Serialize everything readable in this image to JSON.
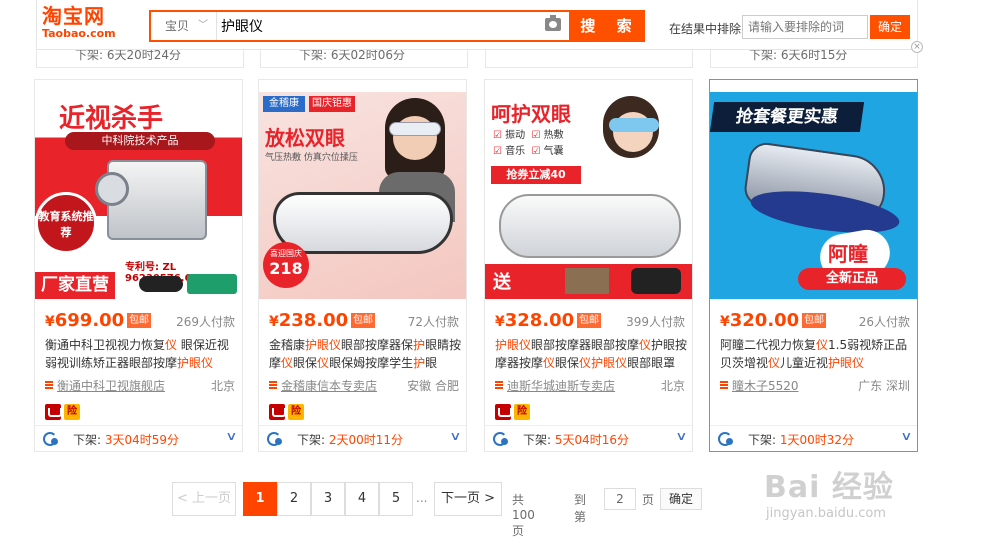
{
  "header": {
    "logo_cn": "淘宝网",
    "logo_en": "Taobao.com",
    "search_type": "宝贝",
    "search_query": "护眼仪",
    "search_button": "搜 索",
    "filter_label": "在结果中排除",
    "filter_placeholder": "请输入要排除的词",
    "filter_button": "确定",
    "close": "×"
  },
  "prev_row": [
    {
      "prefix": "下架: ",
      "value": "6天20时24分"
    },
    {
      "prefix": "下架: ",
      "value": "6天02时06分"
    },
    {
      "prefix": "",
      "value": ""
    },
    {
      "prefix": "下架: ",
      "value": "6天6时15分"
    }
  ],
  "products": [
    {
      "yen": "¥",
      "price": "699.00",
      "free_shipping": "包邮",
      "deals": "269人付款",
      "title_parts": [
        "衡通中科卫视视力恢复",
        "仪",
        " 眼保近视弱视训练矫正器眼部按摩",
        "护眼仪"
      ],
      "shop": "衡通中科卫视旗舰店",
      "location": "北京",
      "gold_badge": "险",
      "offline_label": "下架: ",
      "offline_time": "3天04时59分",
      "image": {
        "headline": "近视杀手",
        "sub": "中科院技术产品",
        "badge": "教育系统推荐",
        "patent": "专利号: ZL 96230576.6",
        "footer": "厂家直营"
      }
    },
    {
      "yen": "¥",
      "price": "238.00",
      "free_shipping": "包邮",
      "deals": "72人付款",
      "title_parts": [
        "金稽康",
        "护眼仪",
        "眼部按摩器保",
        "护",
        "眼睛按摩",
        "仪",
        "眼保",
        "仪",
        "眼保姆按摩学生",
        "护",
        "眼"
      ],
      "shop": "金稽康信本专卖店",
      "location": "安徽 合肥",
      "gold_badge": "险",
      "offline_label": "下架: ",
      "offline_time": "2天00时11分",
      "image": {
        "brand": "金稽康",
        "tag": "国庆钜惠",
        "headline": "放松双眼",
        "sub": "气压热敷 仿真穴位揉压",
        "promo": "喜迎国庆",
        "promo_price": "218"
      }
    },
    {
      "yen": "¥",
      "price": "328.00",
      "free_shipping": "包邮",
      "deals": "399人付款",
      "title_parts": [
        "护眼仪",
        "眼部按摩器眼部按摩",
        "仪",
        "护眼按摩器按摩",
        "仪",
        "眼保",
        "仪",
        "护眼",
        "仪",
        "眼部眼罩"
      ],
      "shop": "迪斯华城迪斯专卖店",
      "location": "北京",
      "gold_badge": "险",
      "offline_label": "下架: ",
      "offline_time": "5天04时16分",
      "image": {
        "headline": "呵护双眼",
        "features": [
          "振动",
          "热敷",
          "音乐",
          "气囊"
        ],
        "coupon": "抢券立减40",
        "gift": "送"
      }
    },
    {
      "yen": "¥",
      "price": "320.00",
      "free_shipping": "包邮",
      "deals": "26人付款",
      "title_parts": [
        "阿瞳二代视力恢复",
        "仪",
        "1.5弱视矫正品贝茨增视",
        "仪",
        "儿童近视",
        "护眼仪"
      ],
      "shop": "瞳木子5520",
      "location": "广东 深圳",
      "gold_badge": "",
      "offline_label": "下架: ",
      "offline_time": "1天00时32分",
      "image": {
        "headline": "抢套餐更实惠",
        "brand": "阿瞳",
        "sub": "全新正品"
      }
    }
  ],
  "pagination": {
    "prev": "< 上一页",
    "pages": [
      "1",
      "2",
      "3",
      "4",
      "5"
    ],
    "ellipsis": "...",
    "next": "下一页 >",
    "total": "共 100页",
    "goto_label": "到第",
    "goto_value": "2",
    "page_unit": "页",
    "confirm": "确定"
  },
  "watermark": {
    "main": "Bai 经验",
    "sub": "jingyan.baidu.com"
  },
  "colors": {
    "accent": "#ff4400",
    "link": "#3b6ec7",
    "muted": "#888888"
  }
}
